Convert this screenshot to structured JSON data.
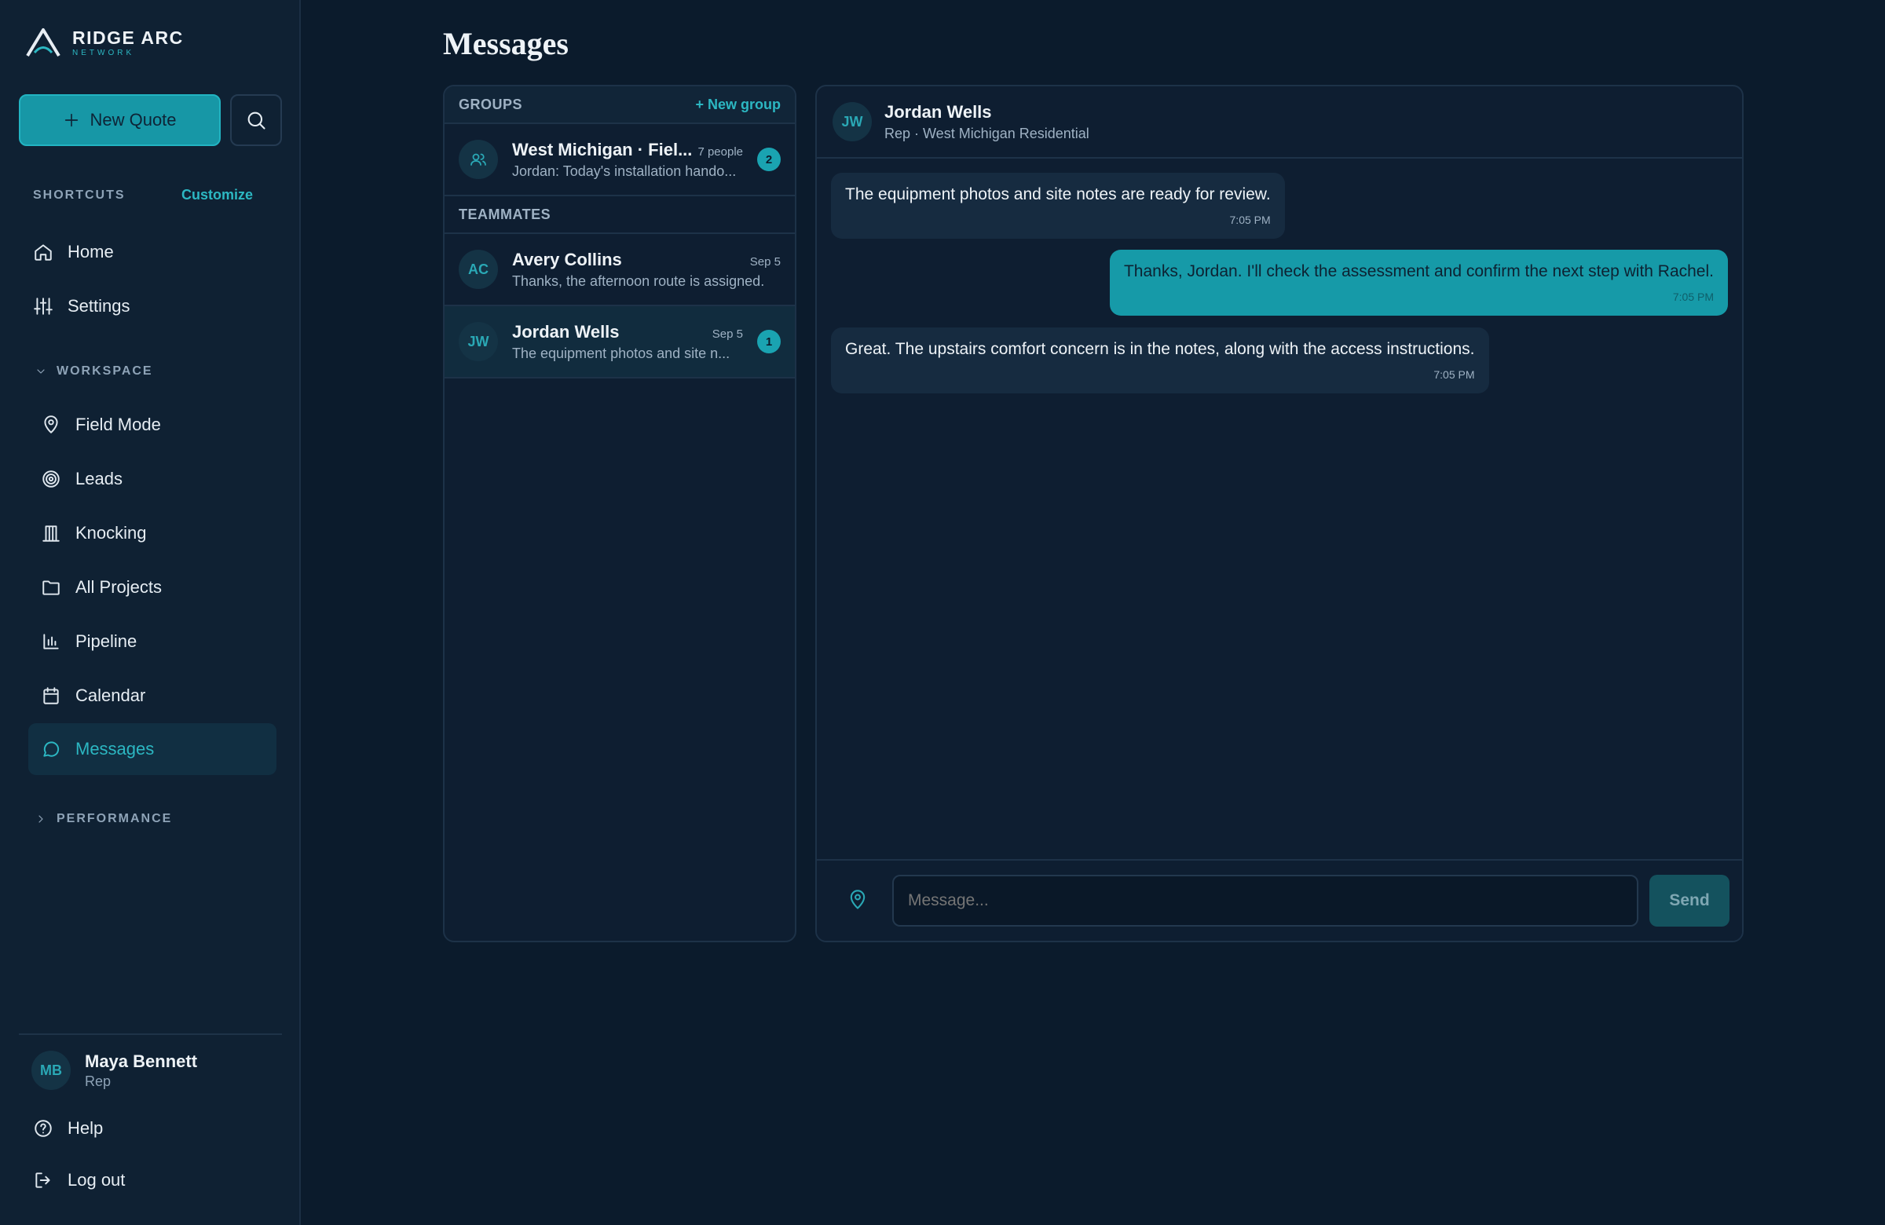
{
  "brand": {
    "name": "RIDGE ARC",
    "sub": "NETWORK"
  },
  "sidebar": {
    "new_quote_label": "New Quote",
    "shortcuts_label": "SHORTCUTS",
    "customize_label": "Customize",
    "shortcuts": [
      {
        "label": "Home",
        "icon": "home-icon"
      },
      {
        "label": "Settings",
        "icon": "sliders-icon"
      }
    ],
    "workspace_label": "WORKSPACE",
    "workspace": [
      {
        "label": "Field Mode",
        "icon": "map-pin-icon"
      },
      {
        "label": "Leads",
        "icon": "target-icon"
      },
      {
        "label": "Knocking",
        "icon": "door-icon"
      },
      {
        "label": "All Projects",
        "icon": "folder-icon"
      },
      {
        "label": "Pipeline",
        "icon": "bar-chart-icon"
      },
      {
        "label": "Calendar",
        "icon": "calendar-icon"
      },
      {
        "label": "Messages",
        "icon": "chat-icon",
        "active": true
      }
    ],
    "performance_label": "PERFORMANCE",
    "user": {
      "initials": "MB",
      "name": "Maya Bennett",
      "role": "Rep"
    },
    "help_label": "Help",
    "logout_label": "Log out"
  },
  "page": {
    "title": "Messages"
  },
  "conversations": {
    "groups_label": "GROUPS",
    "new_group_label": "+ New group",
    "groups": [
      {
        "name": "West Michigan · Fiel...",
        "meta": "7 people",
        "preview": "Jordan: Today's installation hando...",
        "unread": "2"
      }
    ],
    "teammates_label": "TEAMMATES",
    "teammates": [
      {
        "initials": "AC",
        "name": "Avery Collins",
        "meta": "Sep 5",
        "preview": "Thanks, the afternoon route is assigned.",
        "unread": ""
      },
      {
        "initials": "JW",
        "name": "Jordan Wells",
        "meta": "Sep 5",
        "preview": "The equipment photos and site n...",
        "unread": "1"
      }
    ]
  },
  "chat": {
    "initials": "JW",
    "name": "Jordan Wells",
    "subtitle": "Rep · West Michigan Residential",
    "messages": [
      {
        "dir": "in",
        "text": "The equipment photos and site notes are ready for review.",
        "time": "7:05 PM"
      },
      {
        "dir": "out",
        "text": "Thanks, Jordan. I'll check the assessment and confirm the next step with Rachel.",
        "time": "7:05 PM"
      },
      {
        "dir": "in",
        "text": "Great. The upstairs comfort concern is in the notes, along with the access instructions.",
        "time": "7:05 PM"
      }
    ],
    "input_placeholder": "Message...",
    "send_label": "Send"
  },
  "colors": {
    "accent": "#1797a6",
    "background": "#0b1b2c",
    "sidebar": "#0f2133"
  }
}
